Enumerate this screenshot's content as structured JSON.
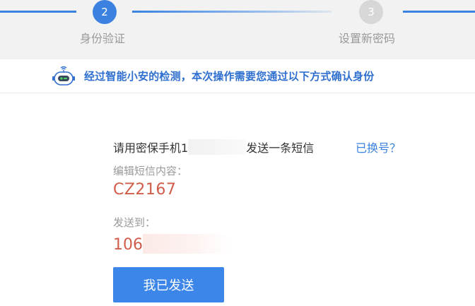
{
  "steps": [
    {
      "number": "2",
      "label": "身份验证",
      "state": "active"
    },
    {
      "number": "3",
      "label": "设置新密码",
      "state": "inactive"
    }
  ],
  "notice": {
    "icon": "robot-icon",
    "text": "经过智能小安的检测，本次操作需要您通过以下方式确认身份"
  },
  "instruction": {
    "prefix": "请用密保手机1",
    "suffix": "发送一条短信",
    "change_link": "已换号？"
  },
  "sms": {
    "edit_label": "编辑短信内容：",
    "code": "CZ2167",
    "send_to_label": "发送到：",
    "number_prefix": "106"
  },
  "action": {
    "send_button": "我已发送"
  },
  "colors": {
    "accent": "#3b82e0",
    "code_red": "#d05d4a",
    "muted_text": "#9a9a9a",
    "step_inactive": "#d7d7d7"
  }
}
